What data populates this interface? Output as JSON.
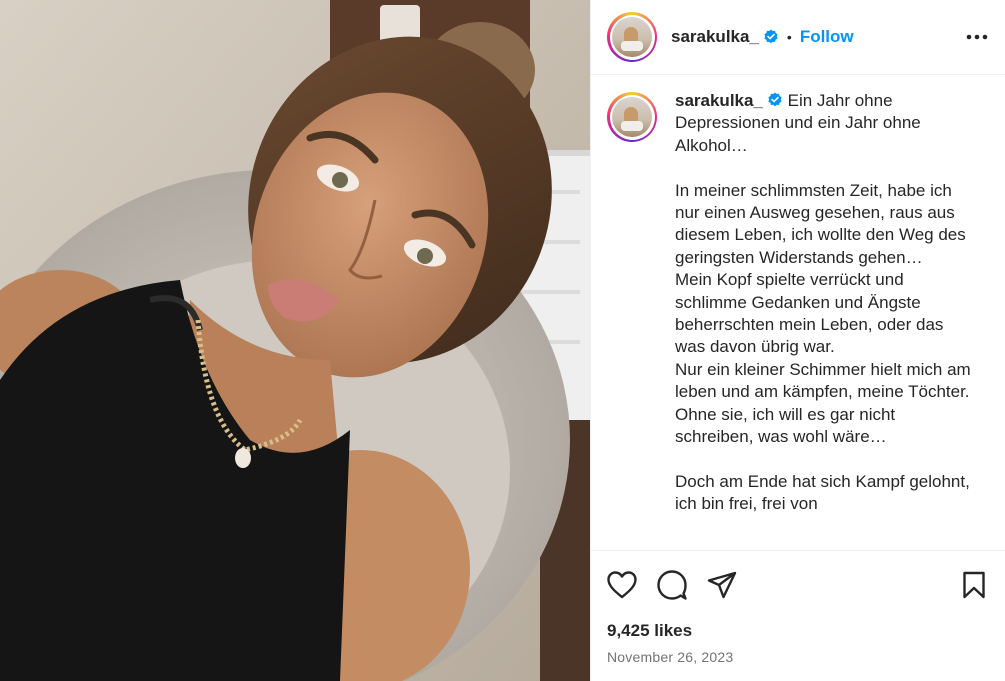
{
  "post": {
    "username": "sarakulka_",
    "follow_label": "Follow",
    "separator": "•",
    "caption": "Ein Jahr ohne Depressionen und ein Jahr ohne Alkohol…\n\nIn meiner schlimmsten Zeit, habe ich nur einen Ausweg gesehen, raus aus diesem Leben, ich wollte den Weg des geringsten Widerstands gehen…\nMein Kopf spielte verrückt und schlimme Gedanken und Ängste beherrschten mein Leben, oder das was davon übrig war.\nNur ein kleiner Schimmer hielt mich am leben und am kämpfen, meine Töchter.\nOhne sie, ich will es gar nicht schreiben, was wohl wäre…\n\nDoch am Ende hat sich Kampf gelohnt, ich bin frei, frei von",
    "likes": "9,425 likes",
    "date": "November 26, 2023"
  },
  "icons": {
    "verified": "verified-badge-icon",
    "more": "more-options-icon",
    "like": "heart-icon",
    "comment": "comment-icon",
    "share": "share-icon",
    "save": "bookmark-icon"
  },
  "colors": {
    "follow": "#0095f6",
    "verified": "#0095f6",
    "date": "#737373"
  }
}
